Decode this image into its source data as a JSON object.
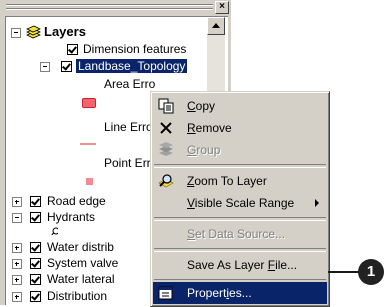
{
  "toc": {
    "layers_label": "Layers",
    "items": [
      {
        "label": "Dimension features"
      },
      {
        "label": "Landbase_Topology"
      },
      {
        "label": "Area Erro"
      },
      {
        "label": "Line Erro"
      },
      {
        "label": "Point Err"
      },
      {
        "label": "Road edge"
      },
      {
        "label": "Hydrants"
      },
      {
        "label": "Water distrib"
      },
      {
        "label": "System valve"
      },
      {
        "label": "Water lateral"
      },
      {
        "label": "Distribution"
      }
    ]
  },
  "menu": {
    "copy": {
      "pre": "",
      "key": "C",
      "post": "opy"
    },
    "remove": {
      "pre": "",
      "key": "R",
      "post": "emove"
    },
    "group": {
      "pre": "",
      "key": "G",
      "post": "roup"
    },
    "zoom": {
      "pre": "",
      "key": "Z",
      "post": "oom To Layer"
    },
    "visible": {
      "pre": "",
      "key": "V",
      "post": "isible Scale Range"
    },
    "datasource": {
      "pre": "",
      "key": "S",
      "post": "et Data Source..."
    },
    "saveas": {
      "pre": "Save As Layer ",
      "key": "F",
      "post": "ile..."
    },
    "properties": {
      "pre": "Propert",
      "key": "i",
      "post": "es..."
    }
  },
  "callout": {
    "number": "1"
  },
  "colors": {
    "selection": "#0a246a",
    "error_symbol": "#f4646e",
    "face": "#d4d0c8"
  }
}
